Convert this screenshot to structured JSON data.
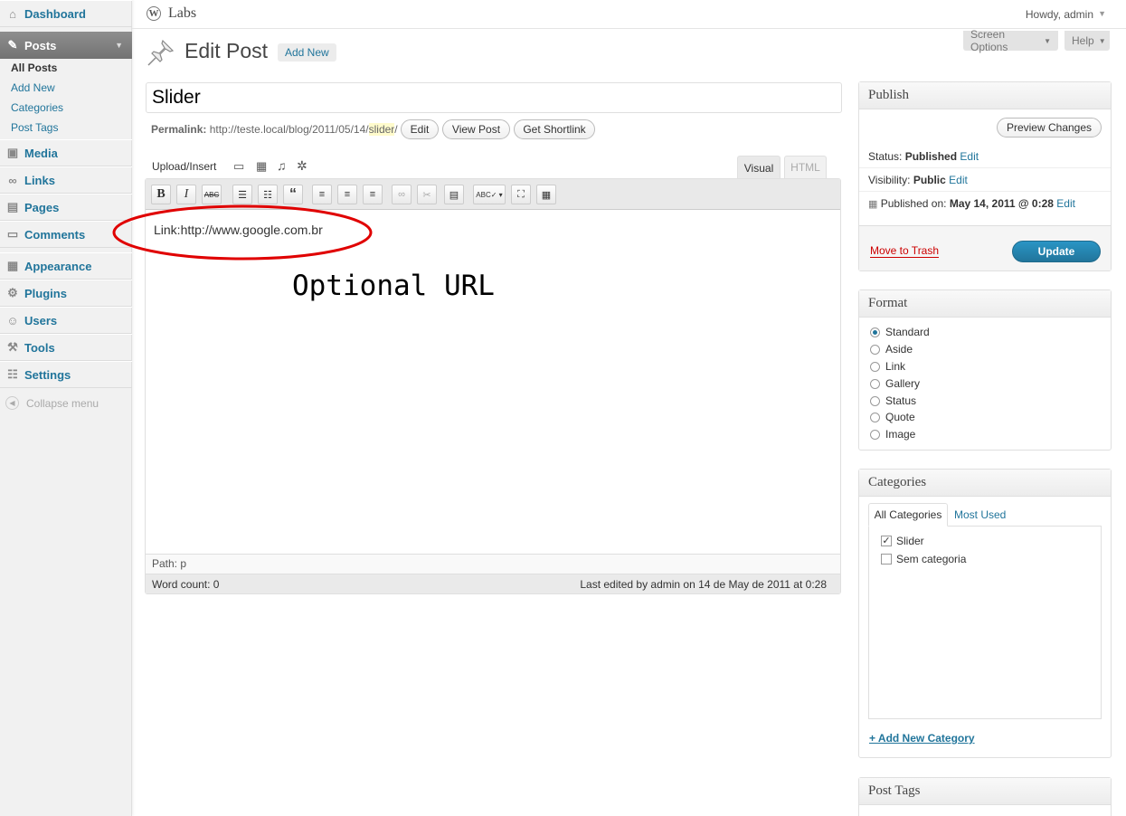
{
  "sidebar": {
    "dashboard": "Dashboard",
    "posts": "Posts",
    "posts_sub": [
      "All Posts",
      "Add New",
      "Categories",
      "Post Tags"
    ],
    "media": "Media",
    "links": "Links",
    "pages": "Pages",
    "comments": "Comments",
    "appearance": "Appearance",
    "plugins": "Plugins",
    "users": "Users",
    "tools": "Tools",
    "settings": "Settings",
    "collapse": "Collapse menu"
  },
  "header": {
    "site": "Labs",
    "howdy": "Howdy, admin",
    "screen_options": "Screen Options",
    "help": "Help"
  },
  "page": {
    "title": "Edit Post",
    "add_new": "Add New"
  },
  "post": {
    "title": "Slider",
    "permalink_label": "Permalink:",
    "permalink_base": "http://teste.local/blog/2011/05/14/",
    "permalink_slug": "slider",
    "permalink_end": "/",
    "edit": "Edit",
    "view": "View Post",
    "shortlink": "Get Shortlink"
  },
  "editor": {
    "upload": "Upload/Insert",
    "tab_visual": "Visual",
    "tab_html": "HTML",
    "content": "Link:http://www.google.com.br",
    "path": "Path: p",
    "word_count": "Word count: 0",
    "last_edited": "Last edited by admin on 14 de May de 2011 at 0:28",
    "annotation": "Optional URL"
  },
  "publish": {
    "heading": "Publish",
    "preview": "Preview Changes",
    "status_label": "Status:",
    "status": "Published",
    "status_edit": "Edit",
    "visibility_label": "Visibility:",
    "visibility": "Public",
    "visibility_edit": "Edit",
    "published_label": "Published on:",
    "published": "May 14, 2011 @ 0:28",
    "published_edit": "Edit",
    "trash": "Move to Trash",
    "update": "Update"
  },
  "format": {
    "heading": "Format",
    "options": [
      "Standard",
      "Aside",
      "Link",
      "Gallery",
      "Status",
      "Quote",
      "Image"
    ],
    "selected": "Standard"
  },
  "categories": {
    "heading": "Categories",
    "tab_all": "All Categories",
    "tab_used": "Most Used",
    "items": [
      {
        "label": "Slider",
        "checked": true
      },
      {
        "label": "Sem categoria",
        "checked": false
      }
    ],
    "add": "+ Add New Category"
  },
  "tags": {
    "heading": "Post Tags"
  },
  "colors": {
    "link": "#21759b",
    "annotation": "#e00000",
    "update": "#2a95c5"
  }
}
